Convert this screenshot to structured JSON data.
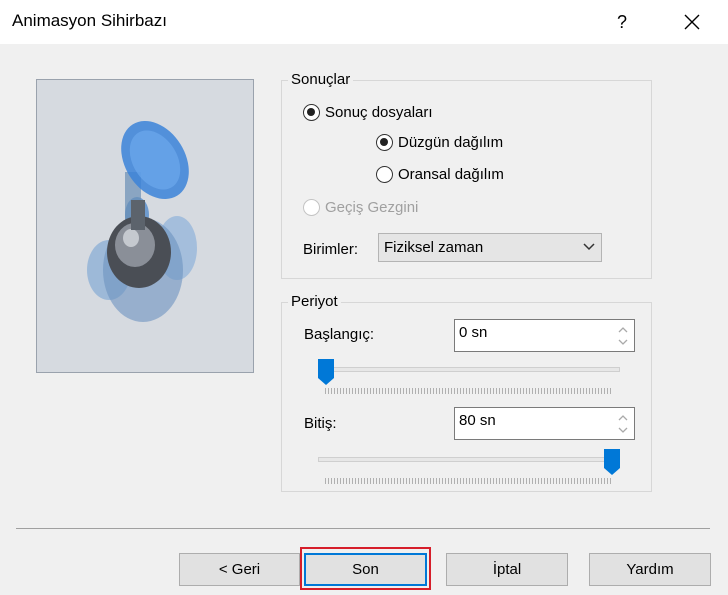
{
  "window": {
    "title": "Animasyon Sihirbazı",
    "help_label": "?"
  },
  "results": {
    "group_title": "Sonuçlar",
    "result_files_label": "Sonuç dosyaları",
    "uniform_label": "Düzgün dağılım",
    "proportional_label": "Oransal dağılım",
    "transition_label": "Geçiş Gezgini",
    "units_label": "Birimler:",
    "units_value": "Fiziksel zaman"
  },
  "period": {
    "group_title": "Periyot",
    "start_label": "Başlangıç:",
    "start_value": "0 sn",
    "start_slider_fraction": 0.0,
    "end_label": "Bitiş:",
    "end_value": "80 sn",
    "end_slider_fraction": 1.0
  },
  "buttons": {
    "back": "< Geri",
    "finish": "Son",
    "cancel": "İptal",
    "help": "Yardım"
  },
  "colors": {
    "accent": "#0078d7",
    "highlight": "#d61e2a"
  }
}
